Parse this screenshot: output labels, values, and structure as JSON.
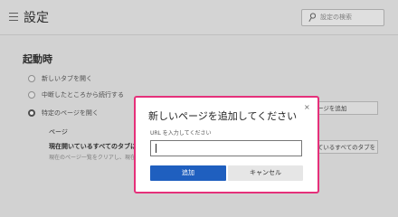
{
  "header": {
    "title": "設定",
    "menu_icon": "hamburger-icon",
    "search_placeholder": "設定の検索",
    "search_icon": "search-icon"
  },
  "startup": {
    "section_title": "起動時",
    "options": [
      {
        "label": "新しいタブを開く",
        "selected": false
      },
      {
        "label": "中断したところから続行する",
        "selected": false
      },
      {
        "label": "特定のページを開く",
        "selected": true
      }
    ],
    "pages_label": "ページ",
    "current_tabs_label": "現在開いているすべてのタブに設定",
    "current_tabs_note": "現在のページ一覧をクリアし、現在開いている",
    "add_page_button": "新しいページを追加",
    "use_all_tabs_button": "現在開いているすべてのタブを使用"
  },
  "dialog": {
    "title": "新しいページを追加してください",
    "close_icon": "close-icon",
    "close_glyph": "×",
    "field_label": "URL を入力してください",
    "field_value": "",
    "add_button": "追加",
    "cancel_button": "キャンセル",
    "highlight_color": "#e5307a",
    "primary_color": "#1f5fbf"
  }
}
